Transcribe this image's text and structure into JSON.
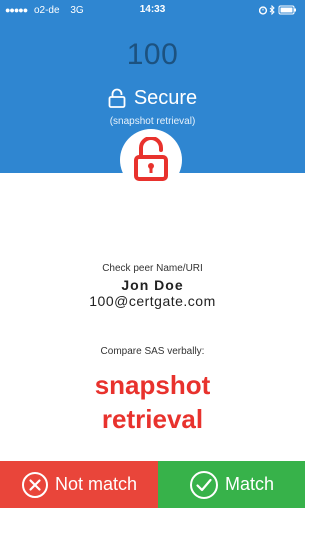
{
  "status_bar": {
    "signal_dots": "●●●●●",
    "carrier": "o2-de",
    "network": "3G",
    "time": "14:33",
    "icons": [
      "alarm-icon",
      "bluetooth-icon",
      "battery-icon"
    ]
  },
  "header": {
    "count": "100",
    "security_status": "Secure",
    "security_detail": "(snapshot retrieval)",
    "lock_icon": "unlocked-padlock-icon",
    "background_color": "#2f86d1",
    "lock_color": "#e8322d"
  },
  "peer": {
    "label": "Check peer Name/URI",
    "name": "Jon Doe",
    "uri": "100@certgate.com"
  },
  "sas": {
    "label": "Compare SAS verbally:",
    "line1": "snapshot",
    "line2": "retrieval",
    "color": "#e8322d"
  },
  "actions": {
    "not_match_label": "Not match",
    "not_match_icon": "x-circle-icon",
    "not_match_color": "#e9453a",
    "match_label": "Match",
    "match_icon": "check-circle-icon",
    "match_color": "#37b24a"
  }
}
